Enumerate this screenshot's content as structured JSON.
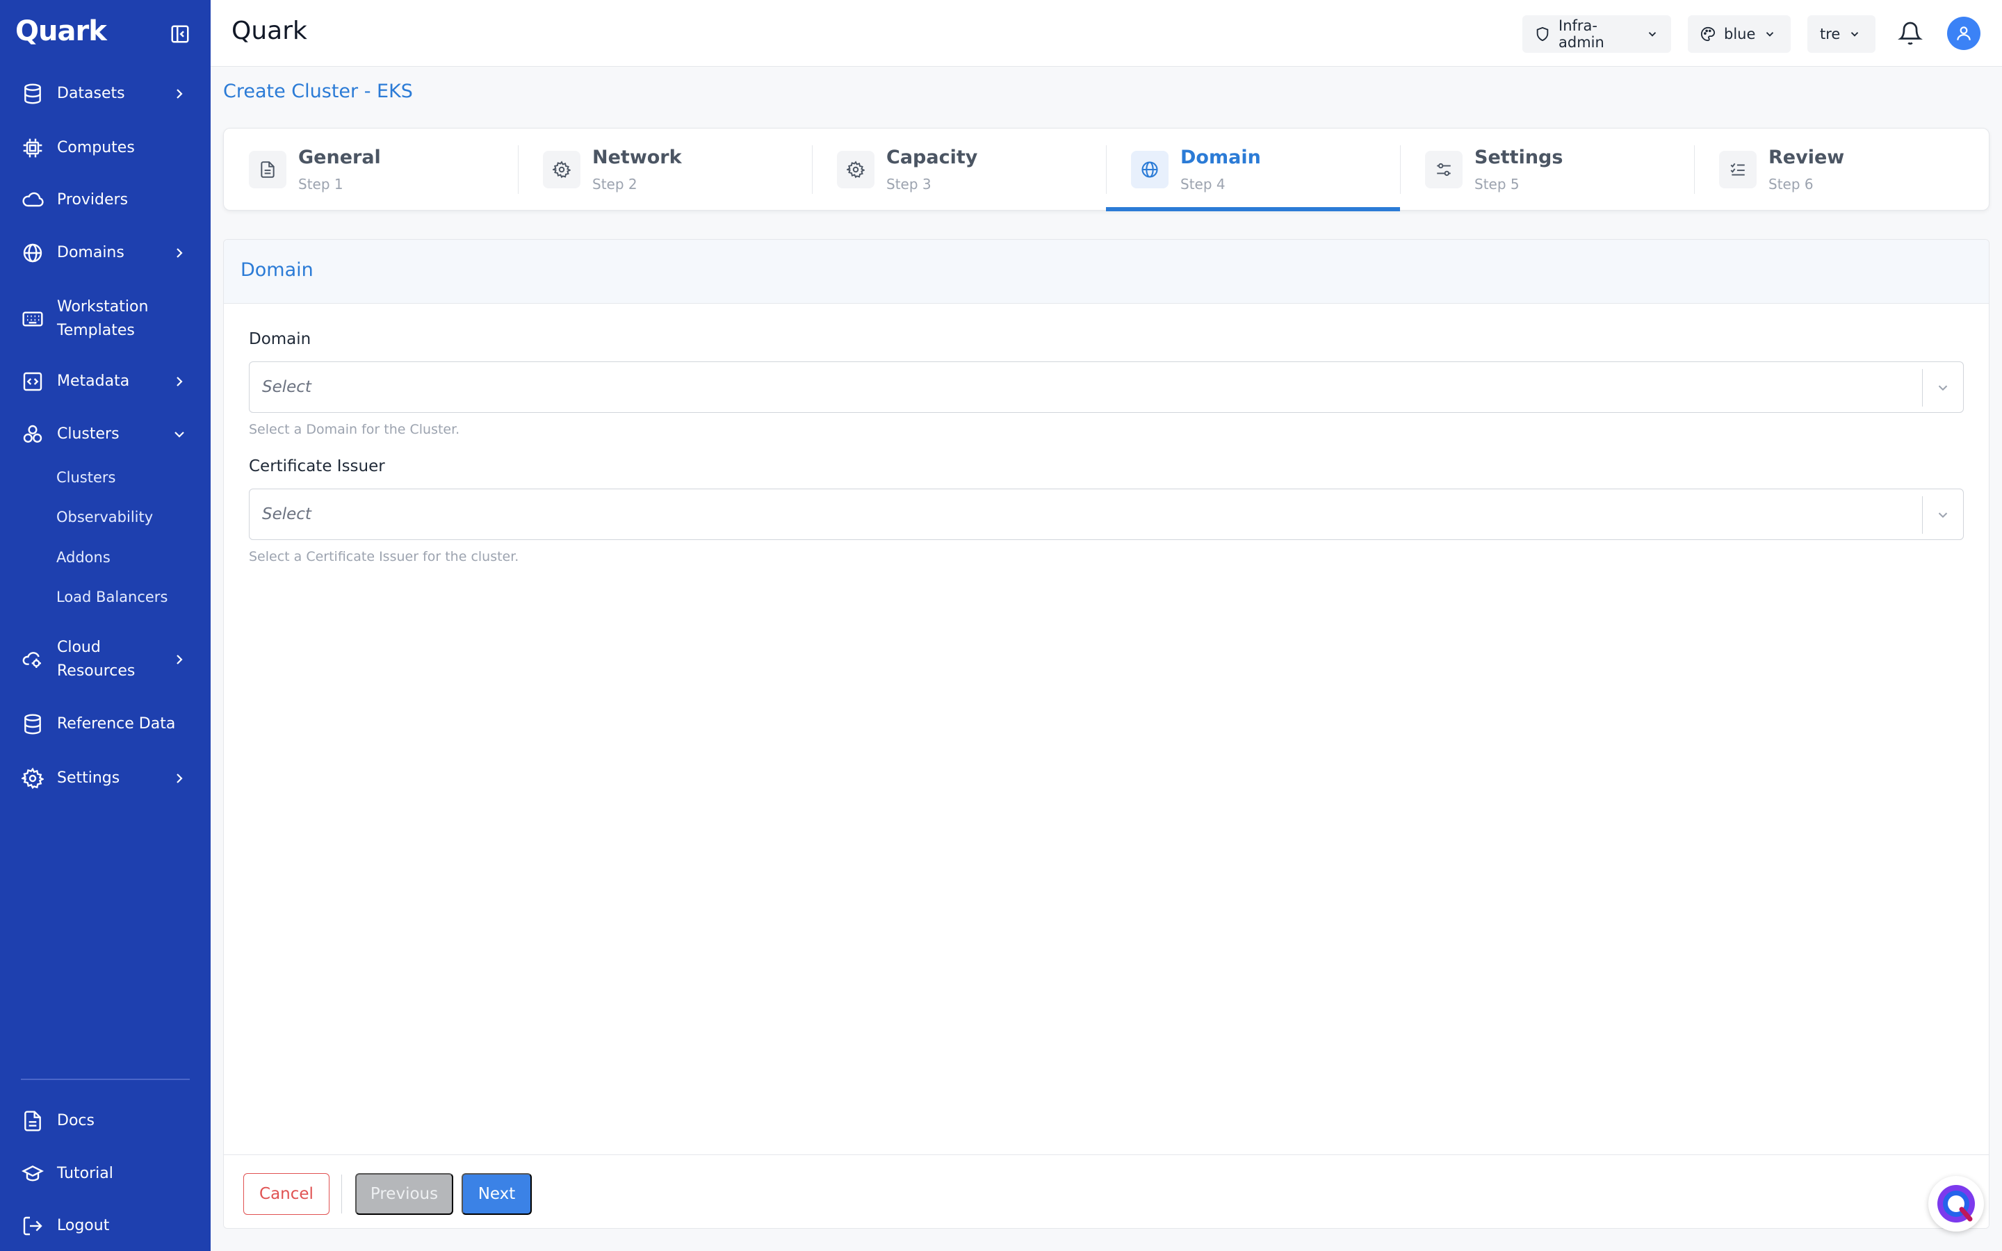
{
  "app": {
    "logo": "Quark",
    "title": "Quark"
  },
  "sidebar": {
    "items": [
      {
        "label": "Datasets",
        "icon": "database-icon"
      },
      {
        "label": "Computes",
        "icon": "chip-icon"
      },
      {
        "label": "Providers",
        "icon": "cloud-icon"
      },
      {
        "label": "Domains",
        "icon": "globe-icon"
      },
      {
        "label": "Workstation",
        "label2": "Templates",
        "icon": "keyboard-icon"
      },
      {
        "label": "Metadata",
        "icon": "code-icon"
      },
      {
        "label": "Clusters",
        "icon": "cluster-icon"
      },
      {
        "label": "Cloud",
        "label2": "Resources",
        "icon": "cloud-cog-icon"
      },
      {
        "label": "Reference Data",
        "icon": "database-icon"
      },
      {
        "label": "Settings",
        "icon": "gear-icon"
      }
    ],
    "cluster_sub": [
      "Clusters",
      "Observability",
      "Addons",
      "Load Balancers"
    ],
    "bottom": [
      {
        "label": "Docs",
        "icon": "file-icon"
      },
      {
        "label": "Tutorial",
        "icon": "graduation-cap-icon"
      },
      {
        "label": "Logout",
        "icon": "logout-icon"
      }
    ]
  },
  "header": {
    "role": "Infra-admin",
    "theme": "blue",
    "tenant": "tre"
  },
  "page": {
    "title": "Create Cluster - EKS"
  },
  "steps": [
    {
      "title": "General",
      "sub": "Step 1"
    },
    {
      "title": "Network",
      "sub": "Step 2"
    },
    {
      "title": "Capacity",
      "sub": "Step 3"
    },
    {
      "title": "Domain",
      "sub": "Step 4"
    },
    {
      "title": "Settings",
      "sub": "Step 5"
    },
    {
      "title": "Review",
      "sub": "Step 6"
    }
  ],
  "form": {
    "section_title": "Domain",
    "domain": {
      "label": "Domain",
      "placeholder": "Select",
      "help": "Select a Domain for the Cluster."
    },
    "issuer": {
      "label": "Certificate Issuer",
      "placeholder": "Select",
      "help": "Select a Certificate Issuer for the cluster."
    }
  },
  "footer": {
    "cancel": "Cancel",
    "previous": "Previous",
    "next": "Next"
  },
  "colors": {
    "sidebar": "#1e40af",
    "accent": "#2b7bd6",
    "danger": "#e05252"
  }
}
